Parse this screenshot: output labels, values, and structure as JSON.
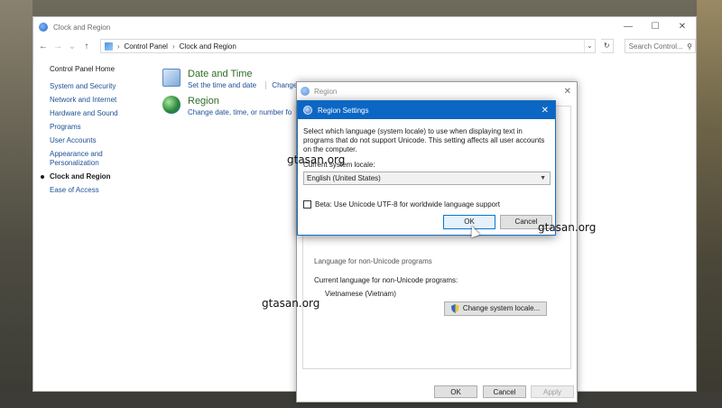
{
  "window": {
    "title": "Clock and Region",
    "controls": {
      "minimize": "—",
      "maximize": "☐",
      "close": "✕"
    }
  },
  "address": {
    "back": "←",
    "forward": "→",
    "up": "↑",
    "recent": "⌄",
    "crumbs": [
      "Control Panel",
      "Clock and Region"
    ],
    "separator": "›",
    "search_placeholder": "Search Control...",
    "refresh": "↻"
  },
  "sidebar": {
    "home": "Control Panel Home",
    "items": [
      {
        "label": "System and Security"
      },
      {
        "label": "Network and Internet"
      },
      {
        "label": "Hardware and Sound"
      },
      {
        "label": "Programs"
      },
      {
        "label": "User Accounts"
      },
      {
        "label": "Appearance and Personalization"
      },
      {
        "label": "Clock and Region"
      },
      {
        "label": "Ease of Access"
      }
    ]
  },
  "categories": {
    "datetime": {
      "title": "Date and Time",
      "link1": "Set the time and date",
      "link2": "Change"
    },
    "region": {
      "title": "Region",
      "link1": "Change date, time, or number fo"
    }
  },
  "region_window": {
    "title": "Region",
    "close": "✕",
    "hidden_text": "Language for non-Unicode programs",
    "current_label": "Current language for non-Unicode programs:",
    "current_value": "Vietnamese (Vietnam)",
    "change_button": "Change system locale...",
    "ok": "OK",
    "cancel": "Cancel",
    "apply": "Apply"
  },
  "region_settings": {
    "title": "Region Settings",
    "close": "✕",
    "description": "Select which language (system locale) to use when displaying text in programs that do not support Unicode. This setting affects all user accounts on the computer.",
    "label": "Current system locale:",
    "selected_locale": "English (United States)",
    "beta_label": "Beta: Use Unicode UTF-8 for worldwide language support",
    "beta_checked": false,
    "ok": "OK",
    "cancel": "Cancel"
  },
  "watermarks": [
    "gtasan.org",
    "gtasan.org",
    "gtasan.org"
  ],
  "colors": {
    "accent": "#0b67c3",
    "link": "#1c4f96",
    "category_heading": "#2e6c25"
  }
}
